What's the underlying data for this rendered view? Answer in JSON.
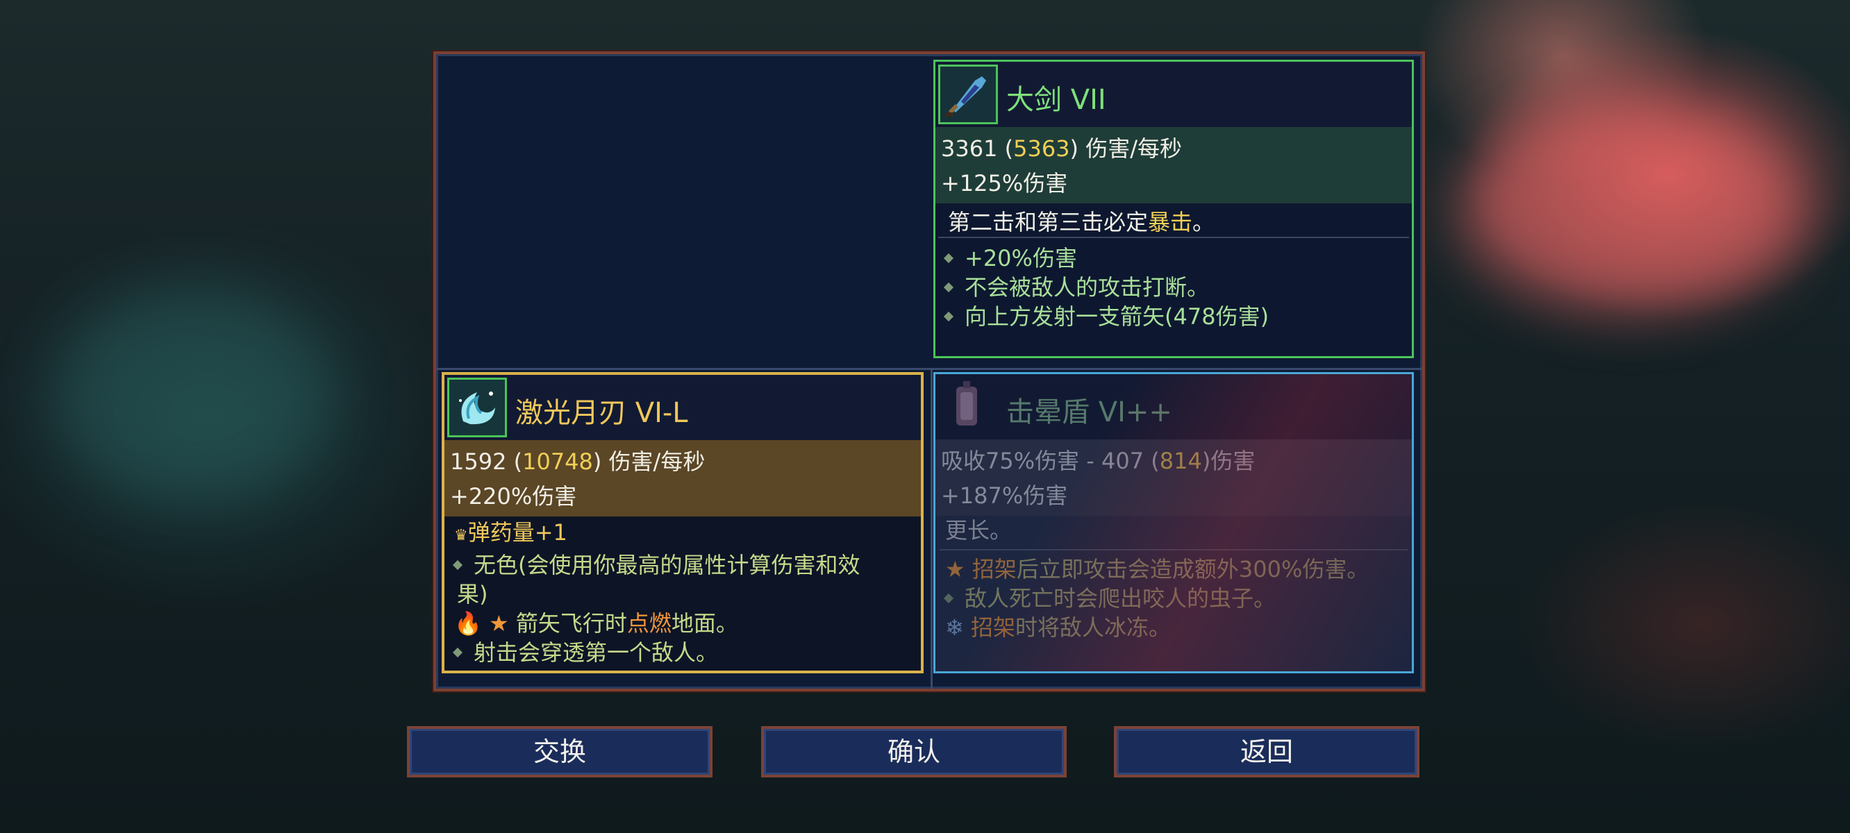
{
  "colors": {
    "panel_bg": "#0e1b35",
    "panel_border": "#7b3f32",
    "green_title": "#7fe07b",
    "gold_title": "#f0c85a",
    "highlight_yellow": "#f0cf55",
    "highlight_orange": "#f0973a"
  },
  "greatsword": {
    "title": "大剑 VII",
    "dps_base": "3361",
    "dps_max": "5363",
    "dps_unit": ") 伤害/每秒",
    "bonus": "+125%伤害",
    "desc_prefix": "第二击和第三击必定",
    "desc_highlight": "暴击",
    "desc_suffix": "。",
    "mods": [
      "+20%伤害",
      "不会被敌人的攻击打断。",
      "向上方发射一支箭矢(478伤害)"
    ],
    "icon": "greatsword-icon"
  },
  "laser_blade": {
    "title": "激光月刃 VI-L",
    "dps_base": "1592",
    "dps_max": "10748",
    "dps_unit": ") 伤害/每秒",
    "bonus": "+220%伤害",
    "ammo": "弹药量+1",
    "mod1_a": "无色(会使用你最高的属性计算伤害和效",
    "mod1_b": "果)",
    "mod2_prefix": "箭矢飞行时",
    "mod2_highlight": "点燃",
    "mod2_suffix": "地面。",
    "mod3": "射击会穿透第一个敌人。",
    "icon": "laser-moon-blade-icon"
  },
  "stun_shield": {
    "title": "击晕盾 VI++",
    "stat1_prefix": "吸收75%伤害 - 407 (",
    "stat1_max": "814",
    "stat1_suffix": ")伤害",
    "bonus": "+187%伤害",
    "partial_line": "更长。",
    "mod1_highlight": "招架",
    "mod1_suffix": "后立即攻击会造成额外300%伤害。",
    "mod2": "敌人死亡时会爬出咬人的虫子。",
    "mod3_highlight": "招架",
    "mod3_suffix": "时将敌人冰冻。",
    "icon": "stun-shield-icon"
  },
  "buttons": {
    "swap": "交换",
    "confirm": "确认",
    "back": "返回"
  }
}
